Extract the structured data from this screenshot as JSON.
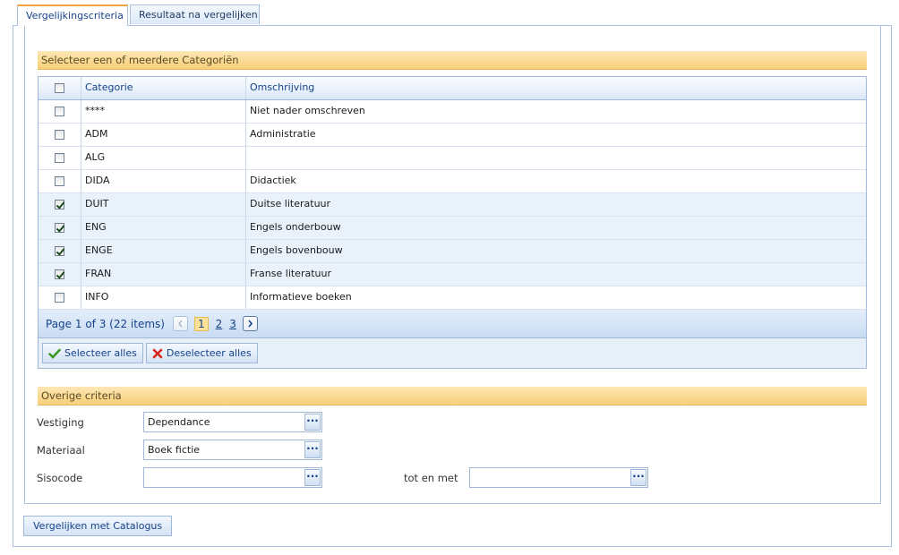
{
  "tabs": [
    {
      "label": "Vergelijkingscriteria",
      "active": true
    },
    {
      "label": "Resultaat na vergelijken",
      "active": false
    }
  ],
  "categories_section": {
    "title": "Selecteer een of meerdere Categoriën",
    "columns": [
      "Categorie",
      "Omschrijving"
    ],
    "rows": [
      {
        "code": "****",
        "description": "Niet nader omschreven",
        "checked": false
      },
      {
        "code": "ADM",
        "description": "Administratie",
        "checked": false
      },
      {
        "code": "ALG",
        "description": "",
        "checked": false
      },
      {
        "code": "DIDA",
        "description": "Didactiek",
        "checked": false
      },
      {
        "code": "DUIT",
        "description": "Duitse literatuur",
        "checked": true
      },
      {
        "code": "ENG",
        "description": "Engels onderbouw",
        "checked": true
      },
      {
        "code": "ENGE",
        "description": "Engels bovenbouw",
        "checked": true
      },
      {
        "code": "FRAN",
        "description": "Franse literatuur",
        "checked": true
      },
      {
        "code": "INFO",
        "description": "Informatieve boeken",
        "checked": false
      }
    ],
    "pager": {
      "summary": "Page 1 of 3 (22 items)",
      "pages": [
        "1",
        "2",
        "3"
      ],
      "current": "1"
    },
    "select_all_label": "Selecteer alles",
    "deselect_all_label": "Deselecteer alles"
  },
  "other_section": {
    "title": "Overige criteria",
    "vestiging_label": "Vestiging",
    "vestiging_value": "Dependance",
    "materiaal_label": "Materiaal",
    "materiaal_value": "Boek fictie",
    "sisocode_label": "Sisocode",
    "sisocode_value": "",
    "tot_label": "tot en met",
    "tot_value": "",
    "ellipsis": "..."
  },
  "compare_button": "Vergelijken met Catalogus",
  "colors": {
    "accent": "#f0a53c",
    "header_orange": "#f7cf78",
    "border_blue": "#9fb8d8",
    "text_blue": "#15428b",
    "check_green": "#3a9a2a",
    "cross_red": "#d8261c"
  }
}
